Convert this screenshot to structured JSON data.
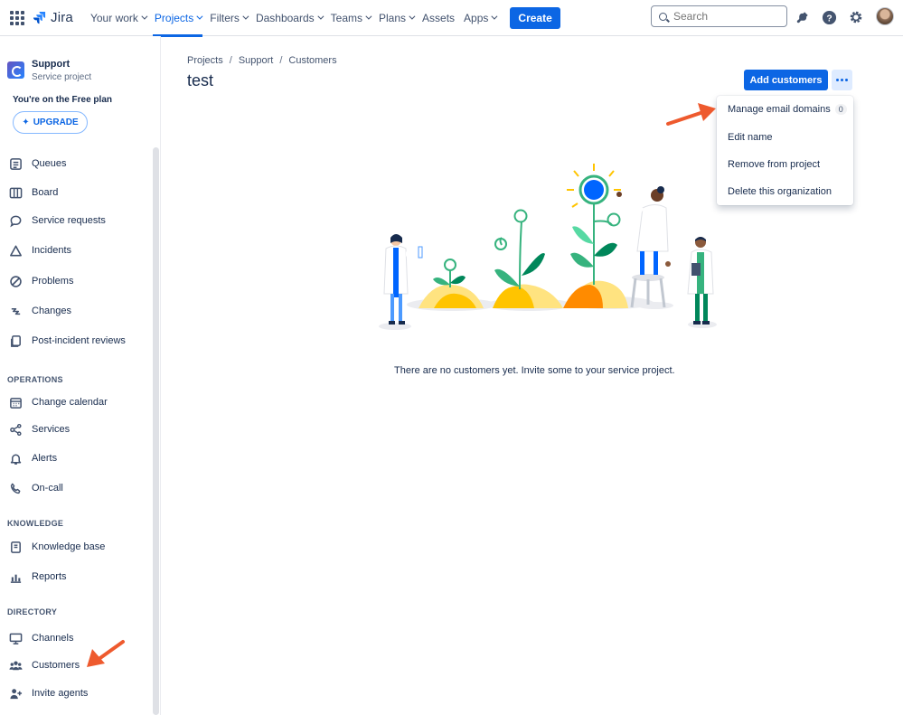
{
  "topnav": {
    "app_name": "Jira",
    "items": [
      {
        "label": "Your work",
        "chevron": true
      },
      {
        "label": "Projects",
        "chevron": true,
        "active": true
      },
      {
        "label": "Filters",
        "chevron": true
      },
      {
        "label": "Dashboards",
        "chevron": true
      },
      {
        "label": "Teams",
        "chevron": true
      },
      {
        "label": "Plans",
        "chevron": true
      },
      {
        "label": "Assets",
        "chevron": false
      },
      {
        "label": "Apps",
        "chevron": true
      }
    ],
    "create_label": "Create",
    "search_placeholder": "Search"
  },
  "sidebar": {
    "project_name": "Support",
    "project_type": "Service project",
    "plan_text": "You're on the Free plan",
    "upgrade_label": "UPGRADE",
    "items": [
      {
        "label": "Queues",
        "icon": "queues-icon"
      },
      {
        "label": "Board",
        "icon": "board-icon"
      },
      {
        "label": "Service requests",
        "icon": "chat-icon"
      },
      {
        "label": "Incidents",
        "icon": "warning-icon"
      },
      {
        "label": "Problems",
        "icon": "problems-icon"
      },
      {
        "label": "Changes",
        "icon": "changes-icon"
      },
      {
        "label": "Post-incident reviews",
        "icon": "pages-icon"
      }
    ],
    "sections": {
      "operations": "OPERATIONS",
      "knowledge": "KNOWLEDGE",
      "directory": "DIRECTORY"
    },
    "operations_items": [
      {
        "label": "Change calendar",
        "icon": "calendar-icon"
      },
      {
        "label": "Services",
        "icon": "services-icon"
      },
      {
        "label": "Alerts",
        "icon": "bell-icon"
      },
      {
        "label": "On-call",
        "icon": "phone-icon"
      }
    ],
    "knowledge_items": [
      {
        "label": "Knowledge base",
        "icon": "book-icon"
      },
      {
        "label": "Reports",
        "icon": "reports-icon"
      }
    ],
    "directory_items": [
      {
        "label": "Channels",
        "icon": "monitor-icon"
      },
      {
        "label": "Customers",
        "icon": "people-icon"
      },
      {
        "label": "Invite agents",
        "icon": "person-add-icon"
      }
    ]
  },
  "main": {
    "breadcrumb": [
      "Projects",
      "Support",
      "Customers"
    ],
    "title": "test",
    "add_customers_label": "Add customers",
    "empty_text": "There are no customers yet. Invite some to your service project."
  },
  "menu": {
    "items": [
      {
        "label": "Manage email domains",
        "badge": "0"
      },
      {
        "label": "Edit name"
      },
      {
        "label": "Remove from project"
      },
      {
        "label": "Delete this organization"
      }
    ]
  },
  "colors": {
    "brand": "#0C66E4",
    "annotation_arrow": "#EE5A2E"
  }
}
